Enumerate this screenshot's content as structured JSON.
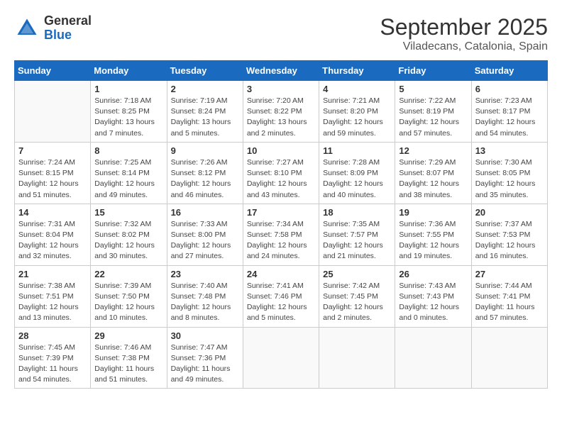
{
  "logo": {
    "general": "General",
    "blue": "Blue"
  },
  "title": "September 2025",
  "location": "Viladecans, Catalonia, Spain",
  "days_of_week": [
    "Sunday",
    "Monday",
    "Tuesday",
    "Wednesday",
    "Thursday",
    "Friday",
    "Saturday"
  ],
  "weeks": [
    [
      {
        "day": "",
        "info": ""
      },
      {
        "day": "1",
        "info": "Sunrise: 7:18 AM\nSunset: 8:25 PM\nDaylight: 13 hours\nand 7 minutes."
      },
      {
        "day": "2",
        "info": "Sunrise: 7:19 AM\nSunset: 8:24 PM\nDaylight: 13 hours\nand 5 minutes."
      },
      {
        "day": "3",
        "info": "Sunrise: 7:20 AM\nSunset: 8:22 PM\nDaylight: 13 hours\nand 2 minutes."
      },
      {
        "day": "4",
        "info": "Sunrise: 7:21 AM\nSunset: 8:20 PM\nDaylight: 12 hours\nand 59 minutes."
      },
      {
        "day": "5",
        "info": "Sunrise: 7:22 AM\nSunset: 8:19 PM\nDaylight: 12 hours\nand 57 minutes."
      },
      {
        "day": "6",
        "info": "Sunrise: 7:23 AM\nSunset: 8:17 PM\nDaylight: 12 hours\nand 54 minutes."
      }
    ],
    [
      {
        "day": "7",
        "info": "Sunrise: 7:24 AM\nSunset: 8:15 PM\nDaylight: 12 hours\nand 51 minutes."
      },
      {
        "day": "8",
        "info": "Sunrise: 7:25 AM\nSunset: 8:14 PM\nDaylight: 12 hours\nand 49 minutes."
      },
      {
        "day": "9",
        "info": "Sunrise: 7:26 AM\nSunset: 8:12 PM\nDaylight: 12 hours\nand 46 minutes."
      },
      {
        "day": "10",
        "info": "Sunrise: 7:27 AM\nSunset: 8:10 PM\nDaylight: 12 hours\nand 43 minutes."
      },
      {
        "day": "11",
        "info": "Sunrise: 7:28 AM\nSunset: 8:09 PM\nDaylight: 12 hours\nand 40 minutes."
      },
      {
        "day": "12",
        "info": "Sunrise: 7:29 AM\nSunset: 8:07 PM\nDaylight: 12 hours\nand 38 minutes."
      },
      {
        "day": "13",
        "info": "Sunrise: 7:30 AM\nSunset: 8:05 PM\nDaylight: 12 hours\nand 35 minutes."
      }
    ],
    [
      {
        "day": "14",
        "info": "Sunrise: 7:31 AM\nSunset: 8:04 PM\nDaylight: 12 hours\nand 32 minutes."
      },
      {
        "day": "15",
        "info": "Sunrise: 7:32 AM\nSunset: 8:02 PM\nDaylight: 12 hours\nand 30 minutes."
      },
      {
        "day": "16",
        "info": "Sunrise: 7:33 AM\nSunset: 8:00 PM\nDaylight: 12 hours\nand 27 minutes."
      },
      {
        "day": "17",
        "info": "Sunrise: 7:34 AM\nSunset: 7:58 PM\nDaylight: 12 hours\nand 24 minutes."
      },
      {
        "day": "18",
        "info": "Sunrise: 7:35 AM\nSunset: 7:57 PM\nDaylight: 12 hours\nand 21 minutes."
      },
      {
        "day": "19",
        "info": "Sunrise: 7:36 AM\nSunset: 7:55 PM\nDaylight: 12 hours\nand 19 minutes."
      },
      {
        "day": "20",
        "info": "Sunrise: 7:37 AM\nSunset: 7:53 PM\nDaylight: 12 hours\nand 16 minutes."
      }
    ],
    [
      {
        "day": "21",
        "info": "Sunrise: 7:38 AM\nSunset: 7:51 PM\nDaylight: 12 hours\nand 13 minutes."
      },
      {
        "day": "22",
        "info": "Sunrise: 7:39 AM\nSunset: 7:50 PM\nDaylight: 12 hours\nand 10 minutes."
      },
      {
        "day": "23",
        "info": "Sunrise: 7:40 AM\nSunset: 7:48 PM\nDaylight: 12 hours\nand 8 minutes."
      },
      {
        "day": "24",
        "info": "Sunrise: 7:41 AM\nSunset: 7:46 PM\nDaylight: 12 hours\nand 5 minutes."
      },
      {
        "day": "25",
        "info": "Sunrise: 7:42 AM\nSunset: 7:45 PM\nDaylight: 12 hours\nand 2 minutes."
      },
      {
        "day": "26",
        "info": "Sunrise: 7:43 AM\nSunset: 7:43 PM\nDaylight: 12 hours\nand 0 minutes."
      },
      {
        "day": "27",
        "info": "Sunrise: 7:44 AM\nSunset: 7:41 PM\nDaylight: 11 hours\nand 57 minutes."
      }
    ],
    [
      {
        "day": "28",
        "info": "Sunrise: 7:45 AM\nSunset: 7:39 PM\nDaylight: 11 hours\nand 54 minutes."
      },
      {
        "day": "29",
        "info": "Sunrise: 7:46 AM\nSunset: 7:38 PM\nDaylight: 11 hours\nand 51 minutes."
      },
      {
        "day": "30",
        "info": "Sunrise: 7:47 AM\nSunset: 7:36 PM\nDaylight: 11 hours\nand 49 minutes."
      },
      {
        "day": "",
        "info": ""
      },
      {
        "day": "",
        "info": ""
      },
      {
        "day": "",
        "info": ""
      },
      {
        "day": "",
        "info": ""
      }
    ]
  ]
}
